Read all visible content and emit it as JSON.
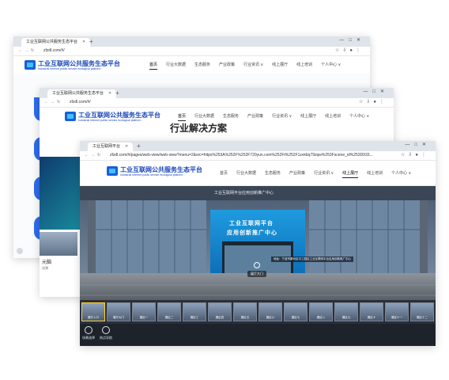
{
  "windows": {
    "back": {
      "tab_title": "工业互联网公共服务生态平台",
      "url": "zfzdl.com/#/",
      "logo_title": "工业互联网公共服务生态平台",
      "logo_subtitle": "Industrial Internet public service ecological platform",
      "menu": [
        "首页",
        "行业大数据",
        "生态服务",
        "产业政策",
        "行业资讯 ∨",
        "线上展厅",
        "线上培训",
        "个人中心 ∨"
      ]
    },
    "middle": {
      "tab_title": "工业互联网公共服务生态平台",
      "url": "zfzdl.com/#/",
      "logo_title": "工业互联网公共服务生态平台",
      "logo_subtitle": "Industrial Internet public service ecological platform",
      "menu": [
        "首页",
        "行业大数据",
        "生态服务",
        "产业政策",
        "行业资讯 ∨",
        "线上展厅",
        "线上培训",
        "个人中心 ∨"
      ],
      "heading": "行业解决方案",
      "left_text_1": "元脑",
      "left_text_2": "浪潮"
    },
    "front": {
      "tab_title": "工业互联网平台",
      "url": "zfzdl.com/#/pages/web-view/web-view?menu=2&src=https%253A%252F%252F720yun.com%252Ft%252F1zvkbq79zqw%253Fscene_id%253D933...",
      "logo_title": "工业互联网公共服务生态平台",
      "logo_subtitle": "Industrial Internet public service ecological platform",
      "menu": [
        "首页",
        "行业大数据",
        "生态服务",
        "产业政策",
        "行业资讯 ∨",
        "线上展厅",
        "线上培训",
        "个人中心 ∨"
      ],
      "scene": {
        "top_sign": "工业互联网平台应用创新推广中心",
        "door_line1": "工业互联网平台",
        "door_line2": "应用创新推广中心",
        "location_caption": "地址：宁波市鄞州区中工园区工业互联网平台应用创新推广中心",
        "hall_label": "展厅大门"
      },
      "thumbnails": [
        "展厅入口",
        "展厅大门",
        "展区一",
        "展区二",
        "展区三",
        "展区四",
        "展区五",
        "展区六",
        "展区七",
        "展区八",
        "展区九",
        "展区十",
        "展区十一",
        "展区十二"
      ],
      "bottom_buttons": [
        "场景选择",
        "热点导航"
      ]
    }
  },
  "colors": {
    "brand_blue": "#1a47b8",
    "accent_yellow": "#ffd12e"
  }
}
